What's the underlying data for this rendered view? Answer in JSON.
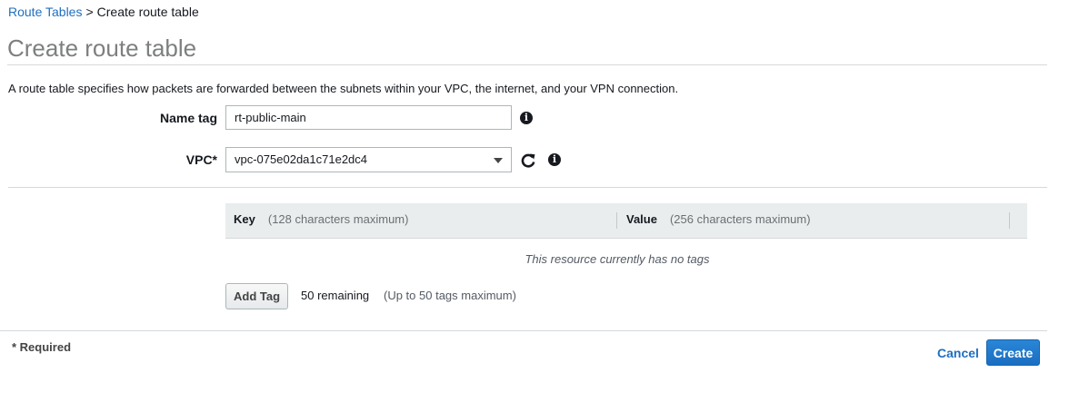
{
  "breadcrumb": {
    "parent": "Route Tables",
    "separator": ">",
    "current": "Create route table"
  },
  "page_title": "Create route table",
  "description": "A route table specifies how packets are forwarded between the subnets within your VPC, the internet, and your VPN connection.",
  "form": {
    "name_tag": {
      "label": "Name tag",
      "value": "rt-public-main"
    },
    "vpc": {
      "label": "VPC*",
      "value": "vpc-075e02da1c71e2dc4"
    }
  },
  "icons": {
    "info": "info-icon",
    "refresh": "refresh-icon",
    "dropdown": "chevron-down-icon"
  },
  "tags": {
    "key_header": "Key",
    "key_hint": "(128 characters maximum)",
    "value_header": "Value",
    "value_hint": "(256 characters maximum)",
    "empty_message": "This resource currently has no tags",
    "add_button": "Add Tag",
    "remaining": "50 remaining",
    "limit": "(Up to 50 tags maximum)"
  },
  "footer": {
    "required_note": "* Required",
    "cancel_label": "Cancel",
    "create_label": "Create"
  },
  "colors": {
    "link": "#1f6fbf",
    "primary_button": "#1b6ec2",
    "table_header_bg": "#eaeded"
  }
}
